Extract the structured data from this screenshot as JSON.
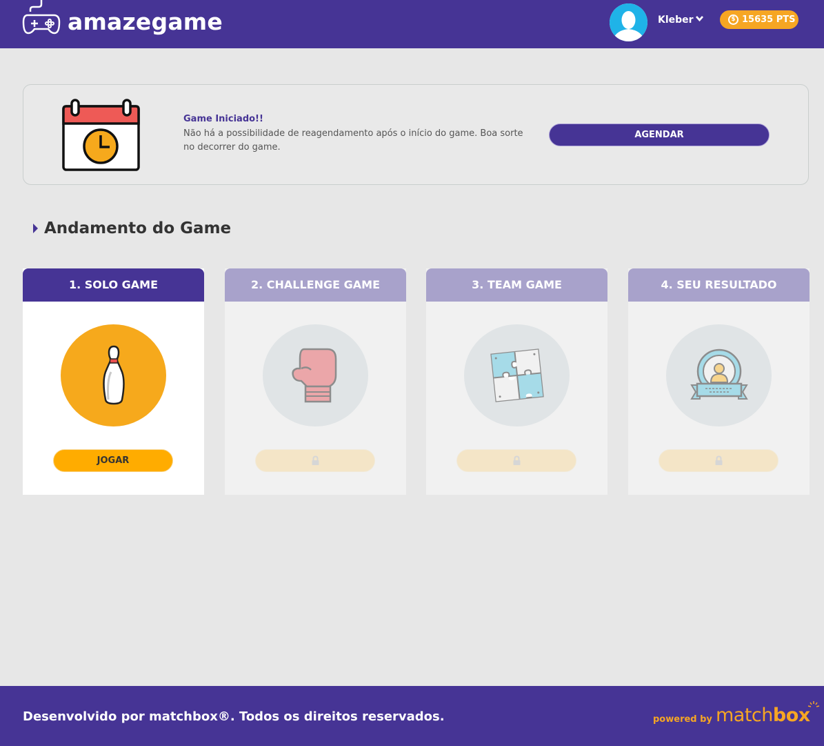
{
  "header": {
    "brand": "amazegame",
    "user_name": "Kleber",
    "points": "15635 PTS",
    "coin_symbol": "$"
  },
  "notice": {
    "title": "Game Iniciado!!",
    "text": "Não há a possibilidade de reagendamento após o início do game. Boa sorte no decorrer do game.",
    "button_label": "AGENDAR"
  },
  "section": {
    "title": "Andamento do Game"
  },
  "cards": [
    {
      "title": "1. SOLO GAME",
      "icon": "bowling-pin-icon",
      "button_label": "JOGAR",
      "locked": false
    },
    {
      "title": "2. CHALLENGE GAME",
      "icon": "boxing-glove-icon",
      "button_label": "",
      "locked": true
    },
    {
      "title": "3. TEAM GAME",
      "icon": "puzzle-icon",
      "button_label": "",
      "locked": true
    },
    {
      "title": "4. SEU RESULTADO",
      "icon": "award-badge-icon",
      "button_label": "",
      "locked": true
    }
  ],
  "footer": {
    "copyright": "Desenvolvido por matchbox®. Todos os direitos reservados.",
    "powered_by": "powered by",
    "partner_logo_a": "match",
    "partner_logo_b": "box"
  },
  "colors": {
    "primary": "#463495",
    "accent": "#f6a623",
    "background": "#e7e7e7"
  }
}
